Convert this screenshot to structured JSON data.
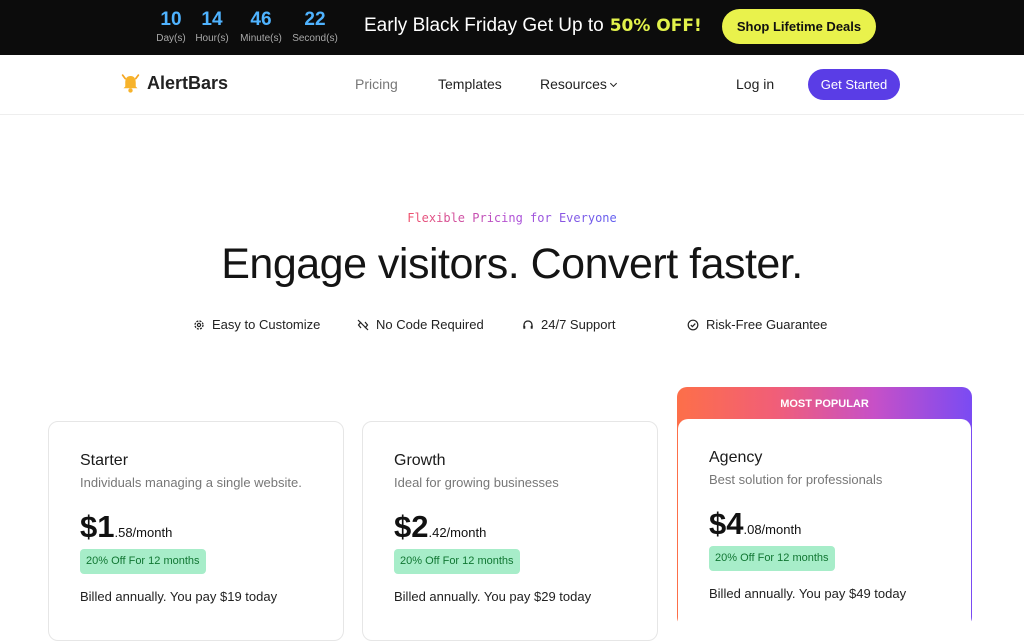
{
  "promo": {
    "countdown": [
      {
        "value": "10",
        "label": "Day(s)"
      },
      {
        "value": "14",
        "label": "Hour(s)"
      },
      {
        "value": "46",
        "label": "Minute(s)"
      },
      {
        "value": "22",
        "label": "Second(s)"
      }
    ],
    "text": "Early Black Friday Get Up to",
    "highlight": "50% OFF!",
    "button": "Shop Lifetime Deals"
  },
  "nav": {
    "logo": "AlertBars",
    "links": [
      "Pricing",
      "Templates",
      "Resources"
    ],
    "login": "Log in",
    "cta": "Get Started"
  },
  "hero": {
    "eyebrow": "Flexible Pricing for Everyone",
    "headline": "Engage visitors. Convert faster.",
    "features": [
      "Easy to Customize",
      "No Code Required",
      "24/7 Support",
      "Risk-Free Guarantee"
    ]
  },
  "plans": [
    {
      "name": "Starter",
      "desc": "Individuals managing a single website.",
      "price_big": "$1",
      "price_small": ".58/month",
      "badge": "20% Off For 12 months",
      "billed": "Billed annually. You pay $19 today"
    },
    {
      "name": "Growth",
      "desc": "Ideal for growing businesses",
      "price_big": "$2",
      "price_small": ".42/month",
      "badge": "20% Off For 12 months",
      "billed": "Billed annually. You pay $29 today"
    },
    {
      "name": "Agency",
      "desc": "Best solution for professionals",
      "price_big": "$4",
      "price_small": ".08/month",
      "badge": "20% Off For 12 months",
      "billed": "Billed annually. You pay $49 today",
      "ribbon": "MOST POPULAR"
    }
  ],
  "colors": {
    "accent": "#5a3de6",
    "promo_bg": "#0c0c0c",
    "lime": "#e9f24c",
    "badge": "#a7edc9",
    "countdown": "#4fb3ff"
  }
}
